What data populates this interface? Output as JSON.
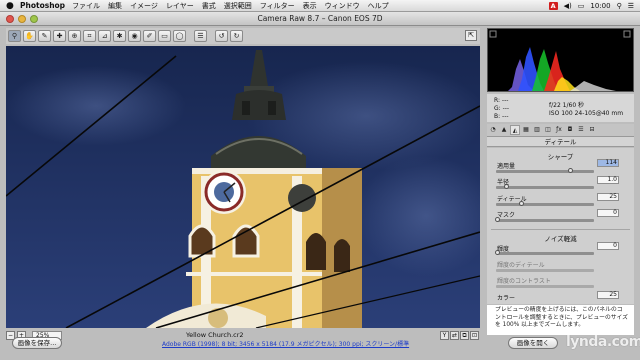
{
  "menubar": {
    "app": "Photoshop",
    "items": [
      "ファイル",
      "編集",
      "イメージ",
      "レイヤー",
      "書式",
      "選択範囲",
      "フィルター",
      "表示",
      "ウィンドウ",
      "ヘルプ"
    ],
    "right_time": "10:00",
    "adobe_badge": "A"
  },
  "window": {
    "title": "Camera Raw 8.7  –  Canon EOS 7D"
  },
  "toolbar": {
    "tools": [
      "zoom-tool",
      "hand-tool",
      "white-balance-tool",
      "color-sampler-tool",
      "targeted-adjustment-tool",
      "crop-tool",
      "straighten-tool",
      "spot-removal-tool",
      "red-eye-tool",
      "adjustment-brush-tool",
      "graduated-filter-tool",
      "radial-filter-tool",
      "preferences-tool",
      "rotate-left-tool",
      "rotate-right-tool"
    ],
    "glyphs": [
      "⚲",
      "✋",
      "✎",
      "✚",
      "⊕",
      "⌗",
      "⊿",
      "✱",
      "◉",
      "✐",
      "▭",
      "◯",
      "☰",
      "↺",
      "↻"
    ]
  },
  "image": {
    "filename": "Yellow Church.cr2",
    "zoom": "25%"
  },
  "readout": {
    "r": "R:  ---",
    "g": "G:  ---",
    "b": "B:  ---",
    "aperture_shutter": "f/22   1/60 秒",
    "iso_lens": "ISO 100   24-105@40 mm"
  },
  "panel": {
    "tabs": [
      "◔",
      "▲",
      "◭",
      "▦",
      "▥",
      "◫",
      "ƒx",
      "◘",
      "☰",
      "⊟"
    ],
    "active_tab": 3,
    "title": "ディテール",
    "sharpen": {
      "heading": "シャープ",
      "amount_label": "適用量",
      "amount": "114",
      "radius_label": "半径",
      "radius": "1.0",
      "detail_label": "ディテール",
      "detail": "25",
      "masking_label": "マスク",
      "masking": "0"
    },
    "noise": {
      "heading": "ノイズ軽減",
      "luminance_label": "輝度",
      "luminance": "0",
      "lum_detail_label": "輝度のディテール",
      "lum_contrast_label": "輝度のコントラスト",
      "color_label": "カラー",
      "color": "25"
    },
    "help_text": "プレビューの精度を上げるには、このパネルのコントロールを調整するときに、プレビューのサイズを 100% 以上までズームします。"
  },
  "bottom": {
    "save": "画像を保存...",
    "workflow": "Adobe RGB (1998); 8 bit; 3456 x 5184 (17.9 メガピクセル); 300 ppi; スクリーン/標準",
    "open": "画像を開く",
    "brand": "lynda.com"
  },
  "colors": {
    "sky": "#1d2c5d",
    "tower_yellow": "#e8c36a",
    "tower_dark": "#2c2f2c",
    "highlight_field": "#9db8e5"
  }
}
